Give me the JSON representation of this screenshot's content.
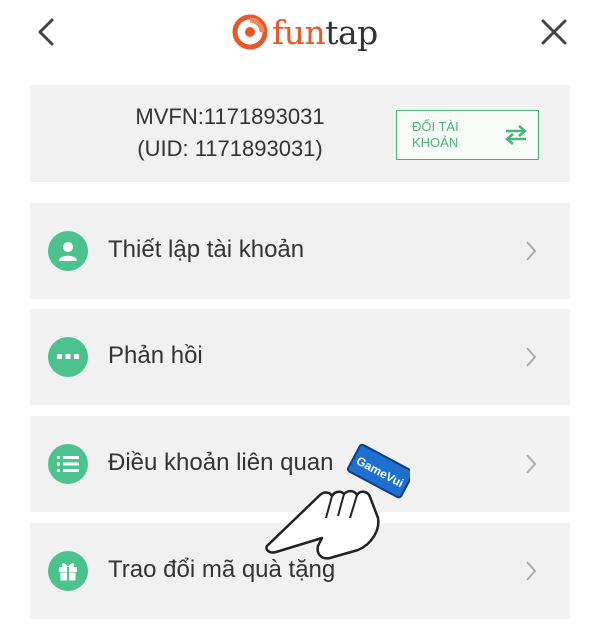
{
  "header": {
    "back_icon": "chevron-left-icon",
    "close_icon": "close-icon",
    "logo": {
      "text_fun": "fun",
      "text_tap": "tap",
      "brand_color": "#e8572a"
    }
  },
  "account": {
    "mvfn": "MVFN:1171893031",
    "uid": "(UID: 1171893031)",
    "switch_label": "ĐỔI TÀI KHOẢN",
    "switch_icon": "swap-arrows-icon"
  },
  "menu": {
    "items": [
      {
        "label": "Thiết lập tài khoản",
        "icon": "user-icon"
      },
      {
        "label": "Phản hồi",
        "icon": "chat-dots-icon"
      },
      {
        "label": "Điều khoản liên quan",
        "icon": "list-icon"
      },
      {
        "label": "Trao đổi mã quà tặng",
        "icon": "gift-icon"
      }
    ]
  },
  "overlay": {
    "hand_icon": "pointing-hand-icon",
    "watermark": "GameVui"
  },
  "colors": {
    "accent_green": "#4cc28f",
    "border_green": "#4ab27a",
    "card_bg": "#f1f1f1"
  }
}
